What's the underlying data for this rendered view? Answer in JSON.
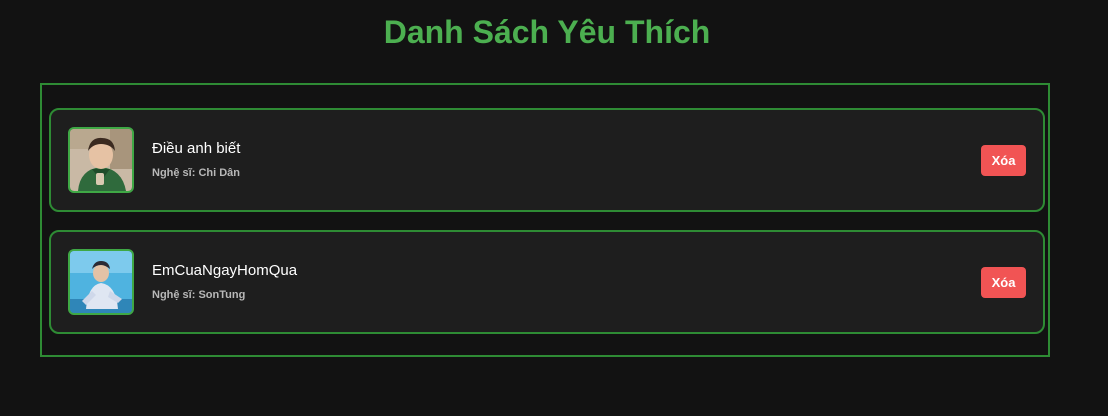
{
  "page": {
    "title": "Danh Sách Yêu Thích"
  },
  "favorites": [
    {
      "title": "Điều anh biết",
      "artist_prefix": "Nghệ sĩ: ",
      "artist": "Chi Dân",
      "delete_label": "Xóa",
      "image": "artist-photo-chi-dan"
    },
    {
      "title": "EmCuaNgayHomQua",
      "artist_prefix": "Nghệ sĩ: ",
      "artist": "SonTung",
      "delete_label": "Xóa",
      "image": "artist-photo-sontung"
    }
  ],
  "colors": {
    "background": "#121212",
    "accent": "#4caf50",
    "border": "#2e8b34",
    "card": "#1e1e1e",
    "delete": "#f15454"
  }
}
